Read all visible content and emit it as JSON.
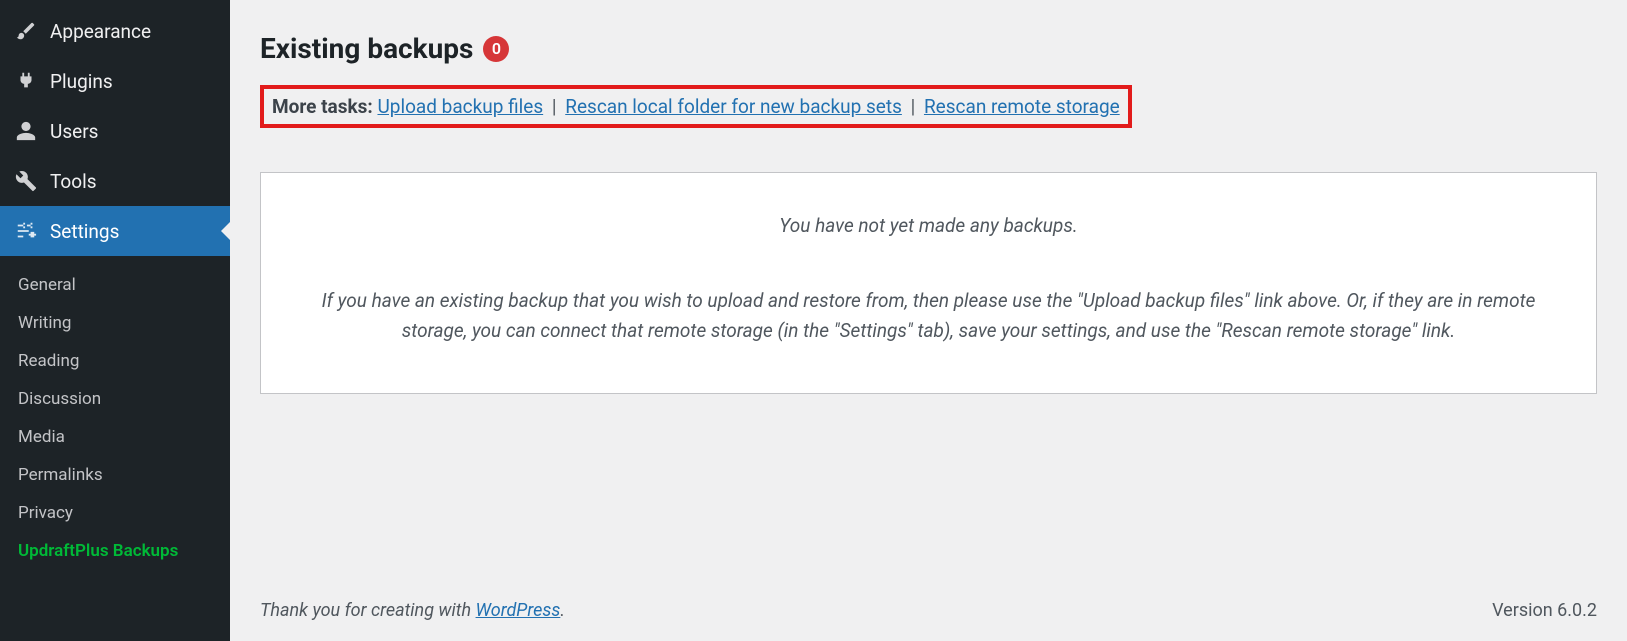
{
  "sidebar": {
    "top": [
      {
        "label": "Appearance"
      },
      {
        "label": "Plugins"
      },
      {
        "label": "Users"
      },
      {
        "label": "Tools"
      },
      {
        "label": "Settings"
      }
    ],
    "sub": [
      {
        "label": "General"
      },
      {
        "label": "Writing"
      },
      {
        "label": "Reading"
      },
      {
        "label": "Discussion"
      },
      {
        "label": "Media"
      },
      {
        "label": "Permalinks"
      },
      {
        "label": "Privacy"
      },
      {
        "label": "UpdraftPlus Backups"
      }
    ]
  },
  "main": {
    "heading": "Existing backups",
    "badge": "0",
    "more_tasks_label": "More tasks:",
    "links": {
      "upload": "Upload backup files",
      "rescan_local": "Rescan local folder for new backup sets",
      "rescan_remote": "Rescan remote storage"
    },
    "separator": " | ",
    "panel": {
      "line1": "You have not yet made any backups.",
      "line2": "If you have an existing backup that you wish to upload and restore from, then please use the \"Upload backup files\" link above. Or, if they are in remote storage, you can connect that remote storage (in the \"Settings\" tab), save your settings, and use the \"Rescan remote storage\" link."
    }
  },
  "footer": {
    "prefix": "Thank you for creating with ",
    "link_text": "WordPress",
    "suffix": ".",
    "version": "Version 6.0.2"
  }
}
